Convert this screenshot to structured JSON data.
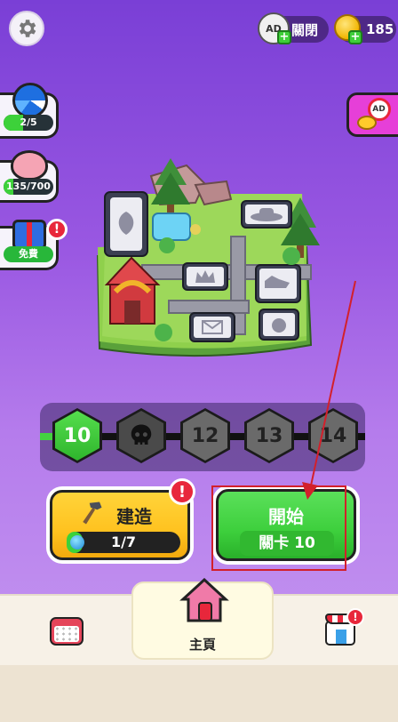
{
  "topbar": {
    "ad_toggle_label": "關閉",
    "ad_badge_text": "AD",
    "coins": "185"
  },
  "side": {
    "spin_progress": "2/5",
    "spin_fraction": 0.4,
    "piggy_progress": "135/700",
    "piggy_fraction": 0.19,
    "gift_label": "免費",
    "gift_badge": "!"
  },
  "noad": {
    "badge_text": "AD"
  },
  "levels": {
    "current": "10",
    "upcoming": [
      "12",
      "13",
      "14"
    ]
  },
  "build": {
    "label": "建造",
    "progress": "1/7",
    "fraction": 0.14,
    "badge": "!"
  },
  "start": {
    "label": "開始",
    "level_label": "關卡 10"
  },
  "nav": {
    "home_label": "主頁",
    "shop_badge": "!"
  },
  "colors": {
    "accent_green": "#3dcf3c",
    "accent_yellow": "#ffc21f",
    "alert_red": "#e8273b",
    "bg_purple": "#9a58e2",
    "arrow_red": "#d3202b"
  }
}
